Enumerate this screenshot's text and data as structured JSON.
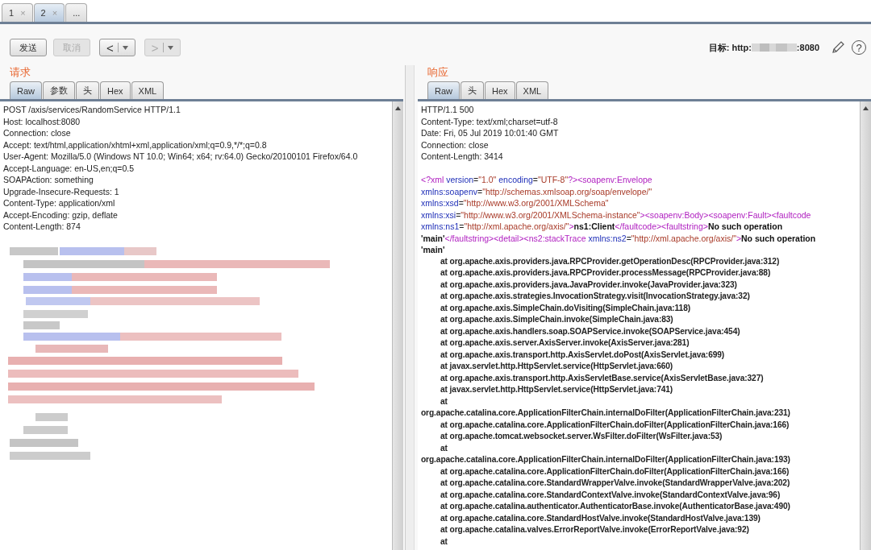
{
  "tabs": [
    {
      "label": "1",
      "close": "×",
      "selected": false
    },
    {
      "label": "2",
      "close": "×",
      "selected": true
    },
    {
      "label": "...",
      "selected": false
    }
  ],
  "toolbar": {
    "send": {
      "label": "发送",
      "disabled": false
    },
    "cancel": {
      "label": "取消",
      "disabled": true
    },
    "nav": [
      {
        "label": "<",
        "disabled": false
      },
      {
        "label": ">",
        "disabled": true
      }
    ],
    "target": {
      "prefix": "目标: http:",
      "suffix": ":8080"
    },
    "help": "?"
  },
  "request": {
    "title": "请求",
    "tabs": [
      {
        "label": "Raw",
        "selected": true
      },
      {
        "label": "参数",
        "selected": false
      },
      {
        "label": "头",
        "selected": false
      },
      {
        "label": "Hex",
        "selected": false
      },
      {
        "label": "XML",
        "selected": false
      }
    ],
    "lines": [
      "POST /axis/services/RandomService HTTP/1.1",
      "Host: localhost:8080",
      "Connection: close",
      "Accept: text/html,application/xhtml+xml,application/xml;q=0.9,*/*;q=0.8",
      "User-Agent: Mozilla/5.0 (Windows NT 10.0; Win64; x64; rv:64.0) Gecko/20100101 Firefox/64.0",
      "Accept-Language: en-US,en;q=0.5",
      "SOAPAction: something",
      "Upgrade-Insecure-Requests: 1",
      "Content-Type: application/xml",
      "Accept-Encoding: gzip, deflate",
      "Content-Length: 874"
    ],
    "body": {
      "kind": "redacted"
    }
  },
  "response": {
    "title": "响应",
    "tabs": [
      {
        "label": "Raw",
        "selected": true
      },
      {
        "label": "头",
        "selected": false
      },
      {
        "label": "Hex",
        "selected": false
      },
      {
        "label": "XML",
        "selected": false
      }
    ],
    "lines": [
      "HTTP/1.1 500",
      "Content-Type: text/xml;charset=utf-8",
      "Date: Fri, 05 Jul 2019 10:01:40 GMT",
      "Connection: close",
      "Content-Length: 3414"
    ],
    "xml_lines": [
      [
        {
          "kind": "tag",
          "text": "<?xml"
        },
        {
          "kind": "attr",
          "text": " version"
        },
        {
          "kind": "punct",
          "text": "="
        },
        {
          "kind": "value",
          "text": "\"1.0\""
        },
        {
          "kind": "attr",
          "text": " encoding"
        },
        {
          "kind": "punct",
          "text": "="
        },
        {
          "kind": "value",
          "text": "\"UTF-8\""
        },
        {
          "kind": "tag",
          "text": "?><soapenv:Envelope"
        }
      ],
      [
        {
          "kind": "attr",
          "text": "xmlns:soapenv"
        },
        {
          "kind": "punct",
          "text": "="
        },
        {
          "kind": "value",
          "text": "\"http://schemas.xmlsoap.org/soap/envelope/\""
        }
      ],
      [
        {
          "kind": "attr",
          "text": "xmlns:xsd"
        },
        {
          "kind": "punct",
          "text": "="
        },
        {
          "kind": "value",
          "text": "\"http://www.w3.org/2001/XMLSchema\""
        }
      ],
      [
        {
          "kind": "attr",
          "text": "xmlns:xsi"
        },
        {
          "kind": "punct",
          "text": "="
        },
        {
          "kind": "value",
          "text": "\"http://www.w3.org/2001/XMLSchema-instance\""
        },
        {
          "kind": "tag",
          "text": "><soapenv:Body><soapenv:Fault><faultcode"
        }
      ],
      [
        {
          "kind": "attr",
          "text": "xmlns:ns1"
        },
        {
          "kind": "punct",
          "text": "="
        },
        {
          "kind": "value",
          "text": "\"http://xml.apache.org/axis/\""
        },
        {
          "kind": "tag",
          "text": ">"
        },
        {
          "kind": "text",
          "text": "ns1:Client"
        },
        {
          "kind": "tag",
          "text": "</faultcode><faultstring>"
        },
        {
          "kind": "text",
          "text": "No such operation"
        }
      ],
      [
        {
          "kind": "text",
          "text": "'main'"
        },
        {
          "kind": "tag",
          "text": "</faultstring><detail><ns2:stackTrace"
        },
        {
          "kind": "attr",
          "text": " xmlns:ns2"
        },
        {
          "kind": "punct",
          "text": "="
        },
        {
          "kind": "value",
          "text": "\"http://xml.apache.org/axis/\""
        },
        {
          "kind": "tag",
          "text": ">"
        },
        {
          "kind": "text",
          "text": "No such operation"
        }
      ],
      [
        {
          "kind": "text",
          "text": "'main'"
        }
      ]
    ],
    "stack_trace": [
      {
        "kind": "frame",
        "text": "at org.apache.axis.providers.java.RPCProvider.getOperationDesc(RPCProvider.java:312)"
      },
      {
        "kind": "frame",
        "text": "at org.apache.axis.providers.java.RPCProvider.processMessage(RPCProvider.java:88)"
      },
      {
        "kind": "frame",
        "text": "at org.apache.axis.providers.java.JavaProvider.invoke(JavaProvider.java:323)"
      },
      {
        "kind": "frame",
        "text": "at org.apache.axis.strategies.InvocationStrategy.visit(InvocationStrategy.java:32)"
      },
      {
        "kind": "frame",
        "text": "at org.apache.axis.SimpleChain.doVisiting(SimpleChain.java:118)"
      },
      {
        "kind": "frame",
        "text": "at org.apache.axis.SimpleChain.invoke(SimpleChain.java:83)"
      },
      {
        "kind": "frame",
        "text": "at org.apache.axis.handlers.soap.SOAPService.invoke(SOAPService.java:454)"
      },
      {
        "kind": "frame",
        "text": "at org.apache.axis.server.AxisServer.invoke(AxisServer.java:281)"
      },
      {
        "kind": "frame",
        "text": "at org.apache.axis.transport.http.AxisServlet.doPost(AxisServlet.java:699)"
      },
      {
        "kind": "frame",
        "text": "at javax.servlet.http.HttpServlet.service(HttpServlet.java:660)"
      },
      {
        "kind": "frame",
        "text": "at org.apache.axis.transport.http.AxisServletBase.service(AxisServletBase.java:327)"
      },
      {
        "kind": "frame",
        "text": "at javax.servlet.http.HttpServlet.service(HttpServlet.java:741)"
      },
      {
        "kind": "frame",
        "text": "at"
      },
      {
        "kind": "wrap",
        "text": "org.apache.catalina.core.ApplicationFilterChain.internalDoFilter(ApplicationFilterChain.java:231)"
      },
      {
        "kind": "frame",
        "text": "at org.apache.catalina.core.ApplicationFilterChain.doFilter(ApplicationFilterChain.java:166)"
      },
      {
        "kind": "frame",
        "text": "at org.apache.tomcat.websocket.server.WsFilter.doFilter(WsFilter.java:53)"
      },
      {
        "kind": "frame",
        "text": "at"
      },
      {
        "kind": "wrap",
        "text": "org.apache.catalina.core.ApplicationFilterChain.internalDoFilter(ApplicationFilterChain.java:193)"
      },
      {
        "kind": "frame",
        "text": "at org.apache.catalina.core.ApplicationFilterChain.doFilter(ApplicationFilterChain.java:166)"
      },
      {
        "kind": "frame",
        "text": "at org.apache.catalina.core.StandardWrapperValve.invoke(StandardWrapperValve.java:202)"
      },
      {
        "kind": "frame",
        "text": "at org.apache.catalina.core.StandardContextValve.invoke(StandardContextValve.java:96)"
      },
      {
        "kind": "frame",
        "text": "at org.apache.catalina.authenticator.AuthenticatorBase.invoke(AuthenticatorBase.java:490)"
      },
      {
        "kind": "frame",
        "text": "at org.apache.catalina.core.StandardHostValve.invoke(StandardHostValve.java:139)"
      },
      {
        "kind": "frame",
        "text": "at org.apache.catalina.valves.ErrorReportValve.invoke(ErrorReportValve.java:92)"
      },
      {
        "kind": "frame",
        "text": "at"
      }
    ]
  }
}
